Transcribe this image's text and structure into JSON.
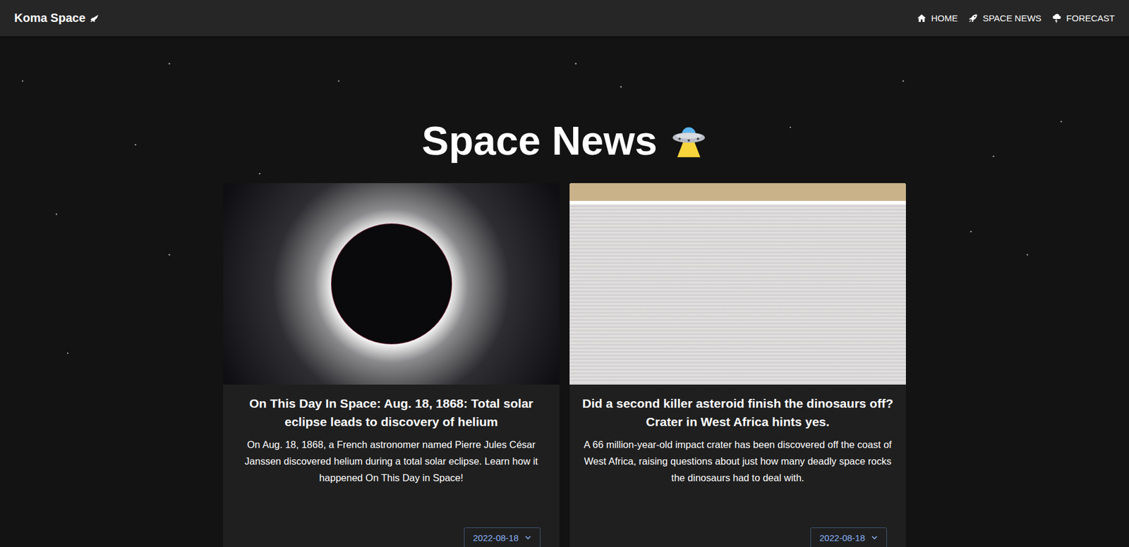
{
  "navbar": {
    "brand": "Koma Space",
    "links": [
      {
        "label": "HOME",
        "icon": "home"
      },
      {
        "label": "SPACE NEWS",
        "icon": "rocket"
      },
      {
        "label": "FORECAST",
        "icon": "storm"
      }
    ]
  },
  "page": {
    "title": "Space News"
  },
  "articles": [
    {
      "title": "On This Day In Space: Aug. 18, 1868: Total solar eclipse leads to discovery of helium",
      "summary": "On Aug. 18, 1868, a French astronomer named Pierre Jules César Janssen discovered helium during a total solar eclipse. Learn how it happened On This Day in Space!",
      "date": "2022-08-18",
      "image": "eclipse"
    },
    {
      "title": "Did a second killer asteroid finish the dinosaurs off? Crater in West Africa hints yes.",
      "summary": "A 66 million-year-old impact crater has been discovered off the coast of West Africa, raising questions about just how many deadly space rocks the dinosaurs had to deal with.",
      "date": "2022-08-18",
      "image": "seismic"
    }
  ]
}
